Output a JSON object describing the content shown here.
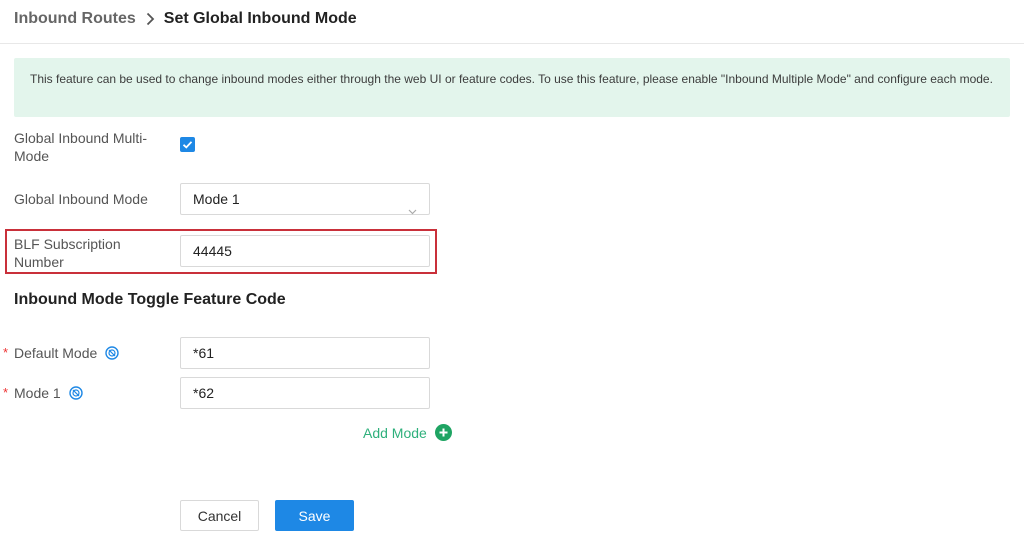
{
  "breadcrumb": {
    "parent": "Inbound Routes",
    "current": "Set Global Inbound Mode"
  },
  "notice": {
    "text": "This feature can be used to change inbound modes either through the web UI or feature codes. To use this feature, please enable \"Inbound Multiple Mode\" and configure each mode."
  },
  "form": {
    "multi_mode_label": "Global Inbound Multi-Mode",
    "multi_mode_checked": true,
    "inbound_mode_label": "Global Inbound Mode",
    "inbound_mode_value": "Mode 1",
    "blf_label": "BLF Subscription Number",
    "blf_value": "44445"
  },
  "feature_code": {
    "section_title": "Inbound Mode Toggle Feature Code",
    "required_mark": "*",
    "default_mode_label": "Default Mode",
    "default_mode_value": "*61",
    "mode1_label": "Mode 1",
    "mode1_value": "*62",
    "add_mode_label": "Add Mode"
  },
  "actions": {
    "cancel_label": "Cancel",
    "save_label": "Save"
  },
  "colors": {
    "accent": "#1e88e5",
    "success": "#1fa463",
    "notice_bg": "#e3f5ec",
    "highlight": "#c9303a",
    "required": "#ee3333"
  }
}
